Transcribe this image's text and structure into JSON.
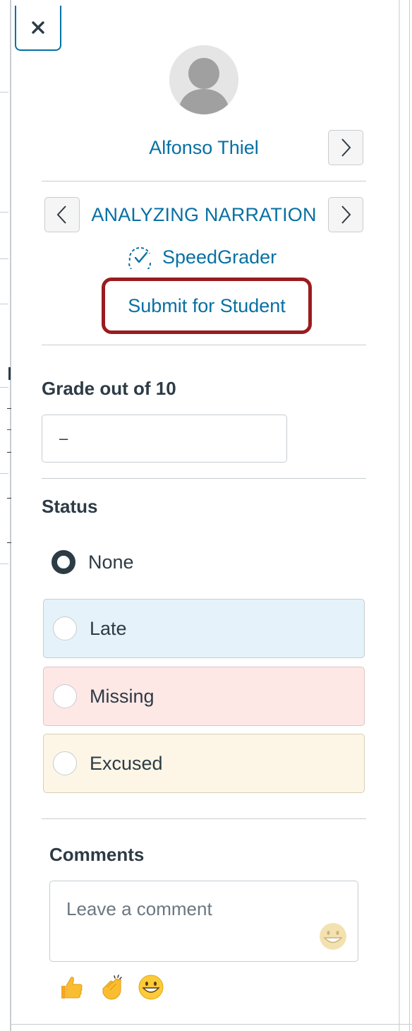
{
  "tray": {
    "close_icon": "close-icon",
    "student": {
      "name": "Alfonso Thiel",
      "avatar_icon": "avatar-placeholder-icon",
      "next_icon": "chevron-right-icon"
    },
    "assignment": {
      "name": "ANALYZING NARRATION",
      "prev_icon": "chevron-left-icon",
      "next_icon": "chevron-right-icon"
    },
    "speedgrader_label": "SpeedGrader",
    "speedgrader_icon": "speedgrader-icon",
    "submit_for_student_label": "Submit for Student",
    "grade": {
      "label": "Grade out of 10",
      "value": "–"
    },
    "status": {
      "label": "Status",
      "options": [
        {
          "label": "None",
          "selected": true
        },
        {
          "label": "Late",
          "selected": false,
          "color": "#e5f2f9"
        },
        {
          "label": "Missing",
          "selected": false,
          "color": "#fde8e6"
        },
        {
          "label": "Excused",
          "selected": false,
          "color": "#fdf6e6"
        }
      ]
    },
    "comments": {
      "label": "Comments",
      "placeholder": "Leave a comment",
      "emoji_picker_icon": "smile-emoji-icon",
      "quick_emojis": [
        "thumbs-up-emoji-icon",
        "clapping-hands-emoji-icon",
        "grinning-face-emoji-icon"
      ]
    }
  },
  "colors": {
    "link": "#0770a3",
    "text": "#2d3b45",
    "highlight_border": "#9b1b1f"
  }
}
